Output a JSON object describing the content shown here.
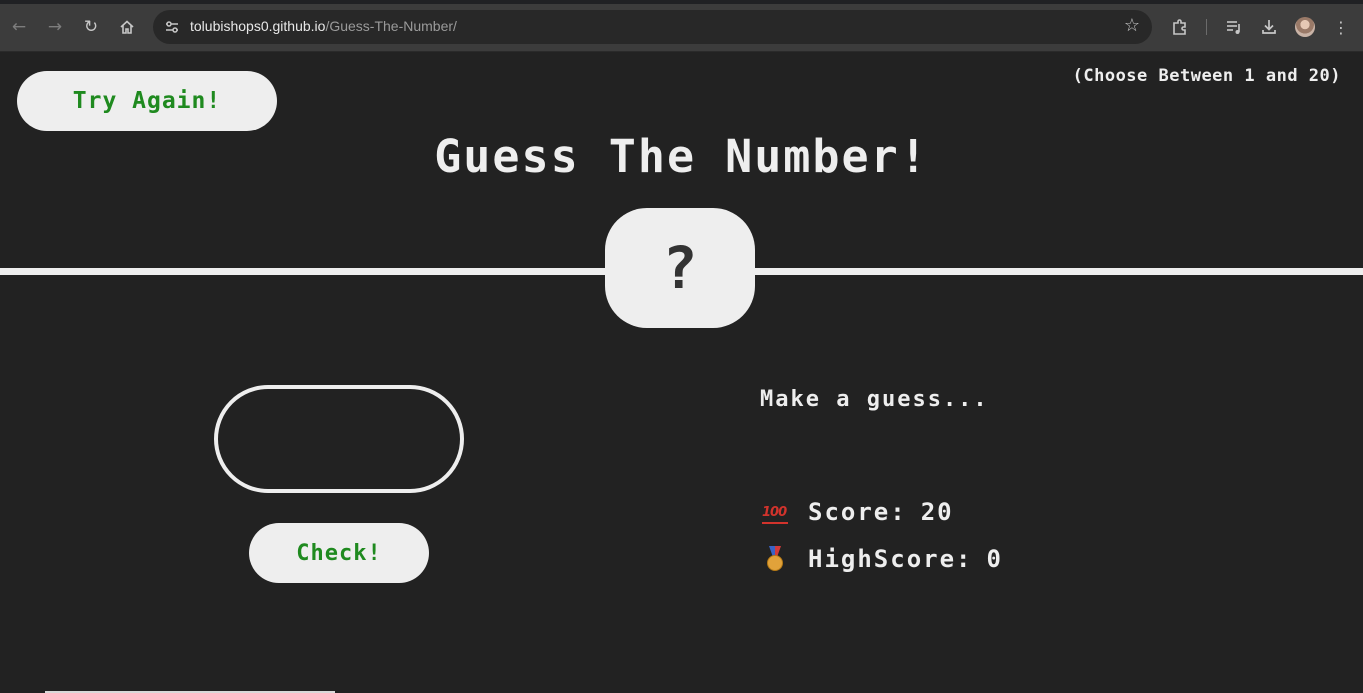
{
  "browser": {
    "url_host": "tolubishops0.github.io",
    "url_path": "/Guess-The-Number/",
    "icons": {
      "back": "arrow-left-icon",
      "forward": "arrow-right-icon",
      "reload": "reload-icon",
      "home": "home-icon",
      "site_info": "tune-icon",
      "bookmark": "star-icon",
      "extensions": "puzzle-icon",
      "media": "media-queue-icon",
      "downloads": "download-icon",
      "menu": "kebab-menu-icon"
    }
  },
  "game": {
    "again_label": "Try Again!",
    "range_hint": "(Choose Between 1 and 20)",
    "title": "Guess The Number!",
    "secret": "?",
    "guess_value": "",
    "check_label": "Check!",
    "message": "Make a guess...",
    "score_icon": "hundred-points-icon",
    "score_label": "Score:",
    "score": "20",
    "highscore_icon": "medal-icon",
    "highscore_label": "HighScore:",
    "highscore": "0"
  },
  "colors": {
    "background": "#222222",
    "foreground": "#eeeeee",
    "button_text": "#1f8a1f"
  }
}
